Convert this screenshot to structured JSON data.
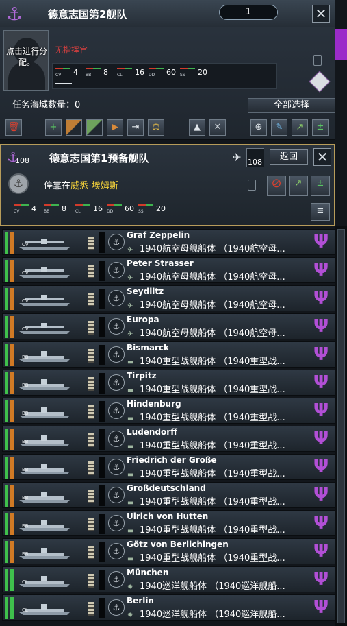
{
  "fleet": {
    "title": "德意志国第2舰队",
    "count": "1",
    "portrait_text": "点击进行分配。",
    "commander": "无指挥官",
    "stats": [
      {
        "abbr": "CV",
        "value": "4"
      },
      {
        "abbr": "BB",
        "value": "8"
      },
      {
        "abbr": "CL",
        "value": "16"
      },
      {
        "abbr": "DD",
        "value": "60"
      },
      {
        "abbr": "SS",
        "value": "20"
      }
    ],
    "mission_label": "任务海域数量：",
    "mission_count": "0",
    "select_all": "全部选择",
    "toolbar": [
      "trash-icon",
      "add-icon",
      "split-icon",
      "merge-icon",
      "transfer-icon",
      "move-icon",
      "balance-icon",
      "up-icon",
      "tools-icon",
      "plus-circle-icon",
      "wrench-icon",
      "upgrade-icon",
      "repair-icon"
    ]
  },
  "reserve": {
    "badge": "108",
    "title": "德意志国第1预备舰队",
    "plane_badge": "108",
    "return_label": "返回",
    "docked_label": "停靠在",
    "docked_place": "威悉-埃姆斯",
    "stats": [
      {
        "abbr": "CV",
        "value": "4"
      },
      {
        "abbr": "BB",
        "value": "8"
      },
      {
        "abbr": "CL",
        "value": "16"
      },
      {
        "abbr": "DD",
        "value": "60"
      },
      {
        "abbr": "SS",
        "value": "20"
      }
    ]
  },
  "colors": {
    "accent": "#b24fd6",
    "gold": "#b79c5a",
    "commander_red": "#d23f3f",
    "place_yellow": "#f1cf3a"
  },
  "ships": [
    {
      "name": "Graf Zeppelin",
      "cls": "1940航空母舰船体 （1940航空母...",
      "type": "CV",
      "org": "#d07a25"
    },
    {
      "name": "Peter Strasser",
      "cls": "1940航空母舰船体 （1940航空母...",
      "type": "CV",
      "org": "#d07a25"
    },
    {
      "name": "Seydlitz",
      "cls": "1940航空母舰船体 （1940航空母...",
      "type": "CV",
      "org": "#d07a25"
    },
    {
      "name": "Europa",
      "cls": "1940航空母舰船体 （1940航空母...",
      "type": "CV",
      "org": "#d07a25"
    },
    {
      "name": "Bismarck",
      "cls": "1940重型战舰船体 （1940重型战...",
      "type": "BB",
      "org": "#d07a25"
    },
    {
      "name": "Tirpitz",
      "cls": "1940重型战舰船体 （1940重型战...",
      "type": "BB",
      "org": "#d07a25"
    },
    {
      "name": "Hindenburg",
      "cls": "1940重型战舰船体 （1940重型战...",
      "type": "BB",
      "org": "#d07a25"
    },
    {
      "name": "Ludendorff",
      "cls": "1940重型战舰船体 （1940重型战...",
      "type": "BB",
      "org": "#d07a25"
    },
    {
      "name": "Friedrich der Große",
      "cls": "1940重型战舰船体 （1940重型战...",
      "type": "BB",
      "org": "#d07a25"
    },
    {
      "name": "Großdeutschland",
      "cls": "1940重型战舰船体 （1940重型战...",
      "type": "BB",
      "org": "#d07a25"
    },
    {
      "name": "Ulrich von Hutten",
      "cls": "1940重型战舰船体 （1940重型战...",
      "type": "BB",
      "org": "#d07a25"
    },
    {
      "name": "Götz von Berlichingen",
      "cls": "1940重型战舰船体 （1940重型战...",
      "type": "BB",
      "org": "#d07a25"
    },
    {
      "name": "München",
      "cls": "1940巡洋舰船体 （1940巡洋舰船...",
      "type": "CL",
      "org": "#3fc04c"
    },
    {
      "name": "Berlin",
      "cls": "1940巡洋舰船体 （1940巡洋舰船...",
      "type": "CL",
      "org": "#3fc04c"
    }
  ]
}
